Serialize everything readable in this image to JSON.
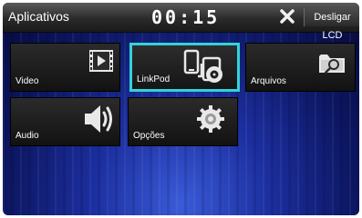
{
  "header": {
    "title": "Aplicativos",
    "clock": "00:15",
    "turn_off_lcd": "Desligar LCD"
  },
  "tiles": [
    {
      "label": "Video",
      "icon": "video-icon"
    },
    {
      "label": "LinkPod",
      "icon": "linkpod-icon",
      "selected": true
    },
    {
      "label": "Arquivos",
      "icon": "folder-search-icon"
    },
    {
      "label": "Audio",
      "icon": "speaker-icon"
    },
    {
      "label": "Opções",
      "icon": "gear-icon"
    }
  ],
  "colors": {
    "selection": "#33d3d8",
    "background": "#1c2fa0",
    "tile": "#1a1a1a"
  }
}
